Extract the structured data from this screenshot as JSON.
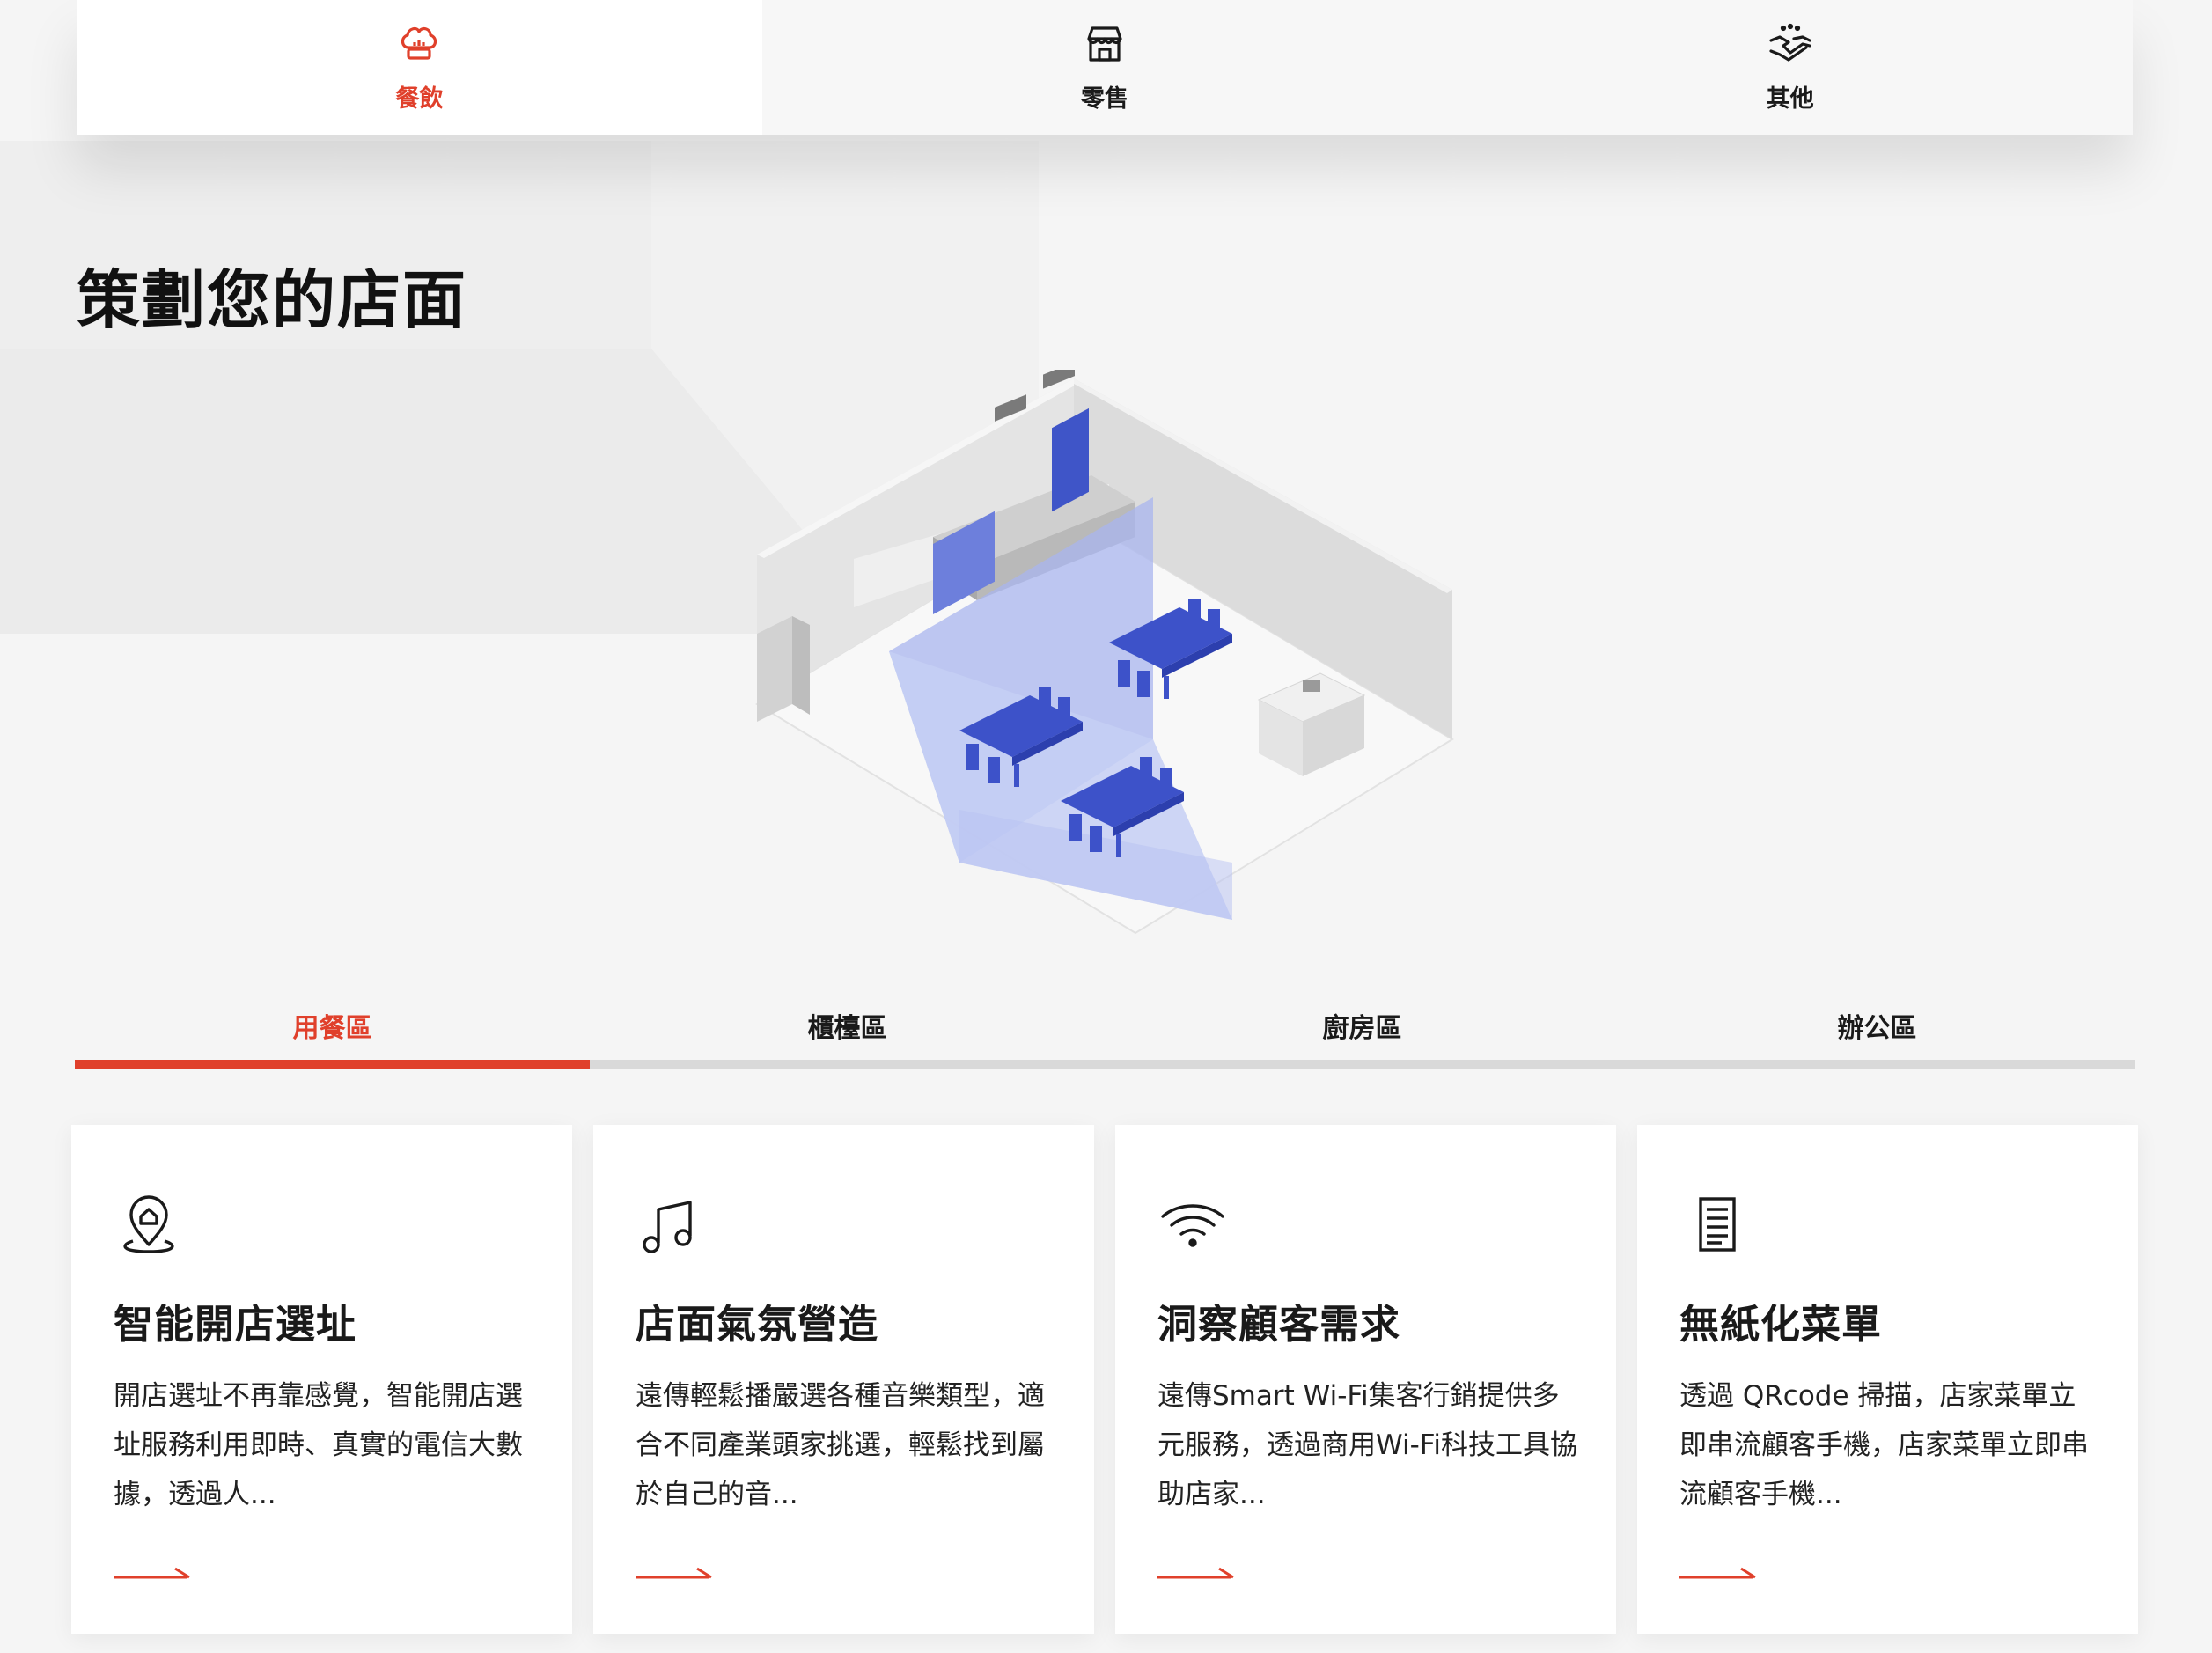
{
  "categories": [
    {
      "label": "餐飲",
      "icon": "chef-hat-icon",
      "active": true
    },
    {
      "label": "零售",
      "icon": "storefront-icon",
      "active": false
    },
    {
      "label": "其他",
      "icon": "handshake-icon",
      "active": false
    }
  ],
  "title": "策劃您的店面",
  "zones": [
    {
      "label": "用餐區",
      "active": true
    },
    {
      "label": "櫃檯區",
      "active": false
    },
    {
      "label": "廚房區",
      "active": false
    },
    {
      "label": "辦公區",
      "active": false
    }
  ],
  "zone_progress": 0.25,
  "cards": [
    {
      "icon": "location-pin-icon",
      "title": "智能開店選址",
      "desc": "開店選址不再靠感覺，智能開店選址服務利用即時、真實的電信大數據，透過人..."
    },
    {
      "icon": "music-note-icon",
      "title": "店面氣氛營造",
      "desc": "遠傳輕鬆播嚴選各種音樂類型，適合不同產業頭家挑選，輕鬆找到屬於自己的音..."
    },
    {
      "icon": "wifi-icon",
      "title": "洞察顧客需求",
      "desc": "遠傳Smart Wi-Fi集客行銷提供多元服務，透過商用Wi-Fi科技工具協助店家..."
    },
    {
      "icon": "paper-menu-icon",
      "title": "無紙化菜單",
      "desc": "透過 QRcode 掃描，店家菜單立即串流顧客手機，店家菜單立即串流顧客手機..."
    }
  ],
  "colors": {
    "accent": "#e0402b",
    "highlight": "#4a5fd6"
  }
}
